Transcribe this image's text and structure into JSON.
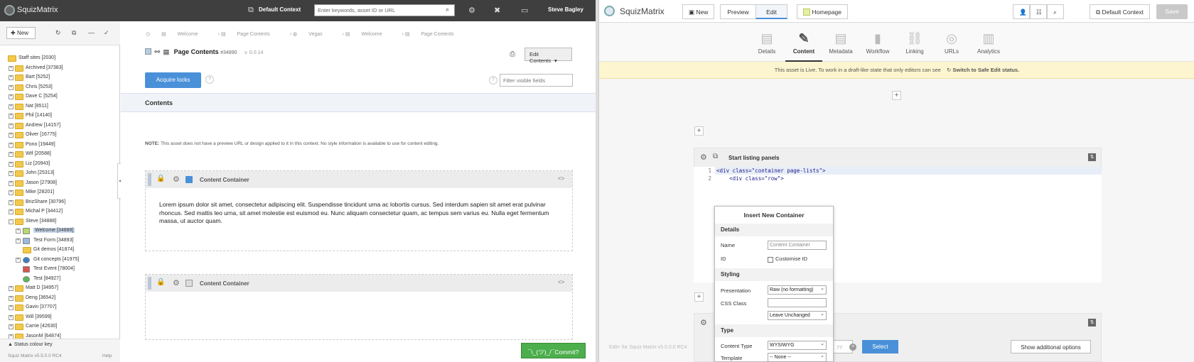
{
  "left": {
    "topbar": {
      "brand": "SquizMatrix",
      "context": "Default Context",
      "search_placeholder": "Enter keywords, asset ID or URL",
      "user": "Steve Bagley"
    },
    "tree_toolbar": {
      "new_label": "New"
    },
    "tree": [
      {
        "label": "Staff sites [2030]",
        "level": 0,
        "expand": ""
      },
      {
        "label": "Archived [37383]",
        "level": 1,
        "expand": "+"
      },
      {
        "label": "Bart [5252]",
        "level": 1,
        "expand": "+"
      },
      {
        "label": "Chris [5253]",
        "level": 1,
        "expand": "+"
      },
      {
        "label": "Dave C [5254]",
        "level": 1,
        "expand": "+"
      },
      {
        "label": "Nat [8511]",
        "level": 1,
        "expand": "+"
      },
      {
        "label": "Phil [14140]",
        "level": 1,
        "expand": "+"
      },
      {
        "label": "Andrew [14157]",
        "level": 1,
        "expand": "+"
      },
      {
        "label": "Oliver [16775]",
        "level": 1,
        "expand": "+"
      },
      {
        "label": "Pono [19449]",
        "level": 1,
        "expand": "+"
      },
      {
        "label": "Wtf [20588]",
        "level": 1,
        "expand": "+"
      },
      {
        "label": "Liz [20943]",
        "level": 1,
        "expand": "+"
      },
      {
        "label": "John [25313]",
        "level": 1,
        "expand": "+"
      },
      {
        "label": "Jason [27908]",
        "level": 1,
        "expand": "+"
      },
      {
        "label": "Mike [28201]",
        "level": 1,
        "expand": "+"
      },
      {
        "label": "BrizShare [30796]",
        "level": 1,
        "expand": "+"
      },
      {
        "label": "Michal P [34412]",
        "level": 1,
        "expand": "+"
      },
      {
        "label": "Steve [34888]",
        "level": 1,
        "expand": "−"
      },
      {
        "label": "Welcome [34889]",
        "level": 2,
        "expand": "+",
        "selected": true,
        "icon": "page"
      },
      {
        "label": "Test Form [34893]",
        "level": 2,
        "expand": "+",
        "icon": "form"
      },
      {
        "label": "Git demos [41874]",
        "level": 2,
        "expand": "",
        "icon": "folder"
      },
      {
        "label": "Git concepts [41975]",
        "level": 2,
        "expand": "+",
        "icon": "globe"
      },
      {
        "label": "Test Event [78004]",
        "level": 2,
        "expand": "",
        "icon": "event"
      },
      {
        "label": "Test [84927]",
        "level": 2,
        "expand": "",
        "icon": "test"
      },
      {
        "label": "Matt D [34957]",
        "level": 1,
        "expand": "+"
      },
      {
        "label": "Deng [36542]",
        "level": 1,
        "expand": "+"
      },
      {
        "label": "Gavin [37707]",
        "level": 1,
        "expand": "+"
      },
      {
        "label": "Will [39599]",
        "level": 1,
        "expand": "+"
      },
      {
        "label": "Carrie [42630]",
        "level": 1,
        "expand": "+"
      },
      {
        "label": "JasonM [64874]",
        "level": 1,
        "expand": "+"
      }
    ],
    "tree_footer": {
      "status_key": "Status colour key",
      "version": "Squiz Matrix v5.5.0.0 RC4",
      "help": "Help"
    },
    "breadcrumb": [
      "Welcome",
      "Page Contents",
      "Vegas",
      "Welcome",
      "Page Contents"
    ],
    "page": {
      "title": "Page Contents",
      "asset_id": "#34890",
      "version": "v. 0.0.14",
      "edit_contents": "Edit Contents",
      "acquire_locks": "Acquire locks",
      "filter_placeholder": "Filter visible fields",
      "section": "Contents",
      "note_bold": "NOTE:",
      "note": "This asset does not have a preview URL or design applied to it in this context. No style information is available to use for content editing."
    },
    "containers": [
      {
        "title": "Content Container",
        "body": "Lorem ipsum dolor sit amet, consectetur adipiscing elit. Suspendisse tincidunt urna ac lobortis cursus. Sed interdum sapien sit amet erat pulvinar rhoncus. Sed mattis leo urna, sit amet molestie est euismod eu. Nunc aliquam consectetur quam, ac tempus sem varius eu. Nulla eget fermentum massa, ut auctor quam."
      },
      {
        "title": "Content Container",
        "body": ""
      }
    ],
    "commit_label": "¯\\_(ツ)_/¯Commit?"
  },
  "right": {
    "brand": "SquizMatrix",
    "toolbar": {
      "new_label": "New",
      "preview_label": "Preview",
      "edit_label": "Edit",
      "homepage_label": "Homepage",
      "context_label": "Default Context",
      "save_label": "Save"
    },
    "tabs": [
      {
        "label": "Details",
        "icon": "▤"
      },
      {
        "label": "Content",
        "icon": "✎",
        "active": true
      },
      {
        "label": "Metadata",
        "icon": "▤"
      },
      {
        "label": "Workflow",
        "icon": "▮"
      },
      {
        "label": "Linking",
        "icon": "⛓"
      },
      {
        "label": "URLs",
        "icon": "◎"
      },
      {
        "label": "Analytics",
        "icon": "▥"
      }
    ],
    "live_notice": "This asset is Live. To work in a draft-like state that only editors can see",
    "safe_edit": "Switch to Safe Edit status.",
    "panel_title": "Start listing panels",
    "code_lines": [
      {
        "n": "1",
        "text": "<div class=\"container page-lists\">"
      },
      {
        "n": "2",
        "text": "    <div class=\"row\">"
      }
    ],
    "modal": {
      "title": "Insert New Container",
      "details": "Details",
      "name_label": "Name",
      "name_placeholder": "Content Container",
      "id_label": "ID",
      "customise_id": "Customise ID",
      "styling": "Styling",
      "presentation_label": "Presentation",
      "presentation_value": "Raw (no formatting)",
      "css_class_label": "CSS Class",
      "class_option": "Leave Unchanged",
      "type": "Type",
      "content_type_label": "Content Type",
      "content_type_value": "WYSIWYG",
      "template_label": "Template",
      "template_value": "-- None --"
    },
    "footer": {
      "version": "Edit+ for Squiz Matrix v5.5.0.0 RC4",
      "partial_id": "77",
      "select_label": "Select",
      "additional_options": "Show additional options"
    }
  }
}
